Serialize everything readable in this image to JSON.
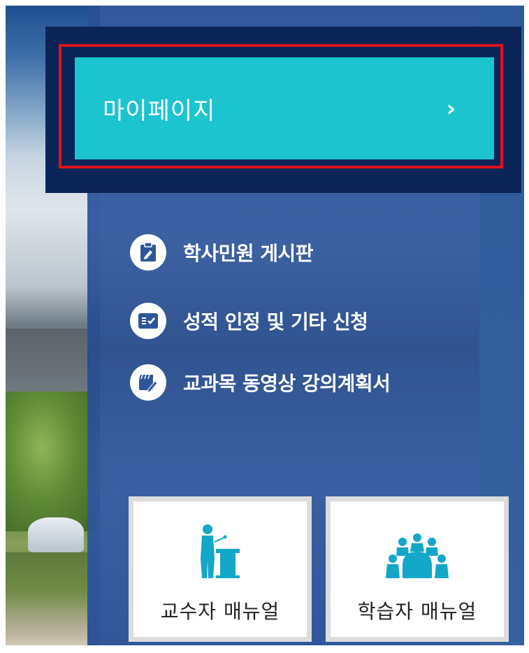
{
  "mypage": {
    "label": "마이페이지",
    "chevron": "›"
  },
  "links": [
    {
      "label": "학사민원 게시판",
      "icon": "edit-clipboard-icon"
    },
    {
      "label": "성적 인정 및 기타 신청",
      "icon": "checklist-icon"
    },
    {
      "label": "교과목 동영상 강의계획서",
      "icon": "clapperboard-icon"
    }
  ],
  "manuals": [
    {
      "label": "교수자 매뉴얼",
      "icon": "lecturer-podium-icon"
    },
    {
      "label": "학습자 매뉴얼",
      "icon": "learners-group-icon"
    }
  ],
  "colors": {
    "panel": "#2d5599",
    "navy_frame": "#0c2558",
    "mypage_button": "#1cc4cf",
    "highlight_outline": "#e0131b",
    "icon_accent": "#13a7c9"
  }
}
